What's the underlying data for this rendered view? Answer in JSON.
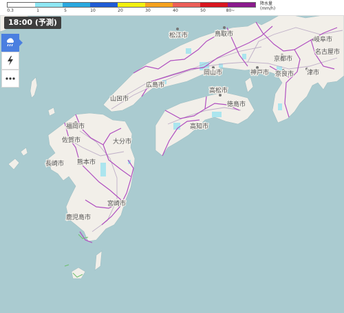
{
  "legend": {
    "ticks": [
      "0.3",
      "1",
      "5",
      "10",
      "20",
      "30",
      "40",
      "50",
      "80~"
    ],
    "colors": [
      "#ffffff",
      "#8ee6f3",
      "#2aa8df",
      "#1f5cd6",
      "#f2f010",
      "#f5a21e",
      "#ec5f58",
      "#d9161f",
      "#8b1a8d"
    ],
    "title_line1": "降水量",
    "title_line2": "(mm/h)"
  },
  "time": {
    "label": "18:00 (予測)"
  },
  "controls": [
    {
      "name": "rain-mode-button",
      "icon": "rain-cloud-icon",
      "active": true
    },
    {
      "name": "thunder-mode-button",
      "icon": "lightning-icon",
      "active": false
    },
    {
      "name": "more-options-button",
      "icon": "more-dots-icon",
      "active": false
    }
  ],
  "cities": [
    {
      "name": "松江市"
    },
    {
      "name": "鳥取市"
    },
    {
      "name": "岡山市"
    },
    {
      "name": "神戸市"
    },
    {
      "name": "京都市"
    },
    {
      "name": "奈良市"
    },
    {
      "name": "津市"
    },
    {
      "name": "岐阜市"
    },
    {
      "name": "名古屋市"
    },
    {
      "name": "広島市"
    },
    {
      "name": "山口市"
    },
    {
      "name": "高松市"
    },
    {
      "name": "徳島市"
    },
    {
      "name": "高知市"
    },
    {
      "name": "福岡市"
    },
    {
      "name": "佐賀市"
    },
    {
      "name": "大分市"
    },
    {
      "name": "長崎市"
    },
    {
      "name": "熊本市"
    },
    {
      "name": "宮崎市"
    },
    {
      "name": "鹿児島市"
    }
  ],
  "colors": {
    "sea": "#aacbd0",
    "land": "#f2efe9",
    "prefecture_border": "#b04fc0",
    "road": "#b9a8c4",
    "rain_light": "#9fe4f0"
  }
}
